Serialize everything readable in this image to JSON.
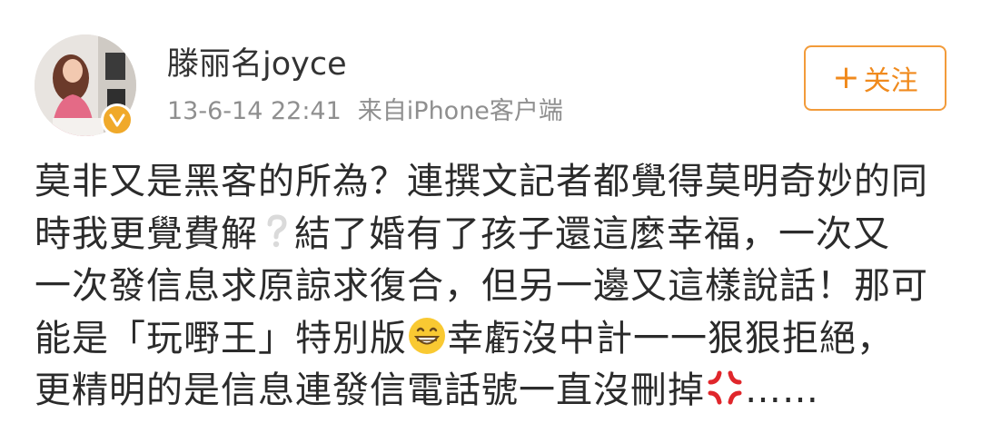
{
  "user": {
    "name": "滕丽名joyce",
    "time": "13-6-14 22:41",
    "source": "来自iPhone客户端"
  },
  "follow": {
    "plus": "+",
    "label": "关注"
  },
  "post": {
    "line1": "莫非又是黑客的所為？連撰文記者都覺得莫明奇妙的同",
    "line2_a": "時我更覺費解",
    "line2_b": "結了婚有了孩子還這麼幸福，一次又",
    "line3": "一次發信息求原諒求復合，但另一邊又這樣說話！那可",
    "line4_a": "能是「玩嘢王」特別版",
    "line4_b": "幸虧沒中計一一狠狠拒絕，",
    "line5_a": "更精明的是信息連發信電話號一直沒刪掉",
    "line5_b": "……"
  },
  "icons": {
    "verified": "verified-badge-icon",
    "question": "white-question-mark-icon",
    "grin": "grinning-face-emoji",
    "anger": "anger-symbol-emoji"
  },
  "colors": {
    "accent": "#f08a1d",
    "verified": "#f0a92a",
    "meta": "#8f8f8f",
    "text": "#2b2b2b"
  }
}
